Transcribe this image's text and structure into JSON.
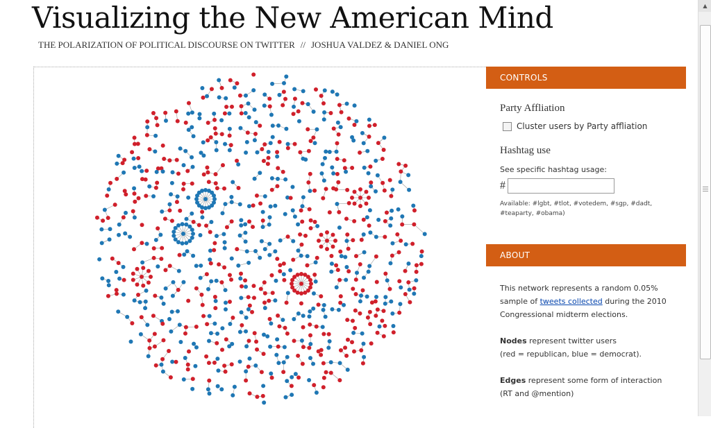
{
  "header": {
    "title": "Visualizing the New American Mind",
    "subtitle": "THE POLARIZATION OF POLITICAL DISCOURSE ON TWITTER",
    "separator": "//",
    "authors": "JOSHUA VALDEZ  & DANIEL ONG"
  },
  "controls": {
    "header": "CONTROLS",
    "party_heading": "Party Affliation",
    "cluster_label": "Cluster users by Party affliation",
    "cluster_checked": false,
    "hashtag_heading": "Hashtag use",
    "hashtag_hint": "See specific hashtag usage:",
    "hash_symbol": "#",
    "hashtag_value": "",
    "available": "Available: #lgbt, #tlot, #votedem, #sgp, #dadt, #teaparty, #obama)"
  },
  "about": {
    "header": "ABOUT",
    "p1_before": "This network represents a random 0.05% sample of ",
    "p1_link": "tweets collected",
    "p1_after": " during the 2010 Congressional midterm elections.",
    "nodes_bold": "Nodes",
    "nodes_text": " represent twitter users",
    "nodes_legend": "(red = republican, blue = democrat).",
    "edges_bold": "Edges",
    "edges_text": " represent some form of interaction",
    "edges_legend": "(RT and @mention)"
  },
  "colors": {
    "republican": "#d0202b",
    "democrat": "#1f77b4",
    "edge": "#999999",
    "accent": "#d35e14"
  },
  "icons": {
    "scroll_up": "triangle-up-icon"
  }
}
